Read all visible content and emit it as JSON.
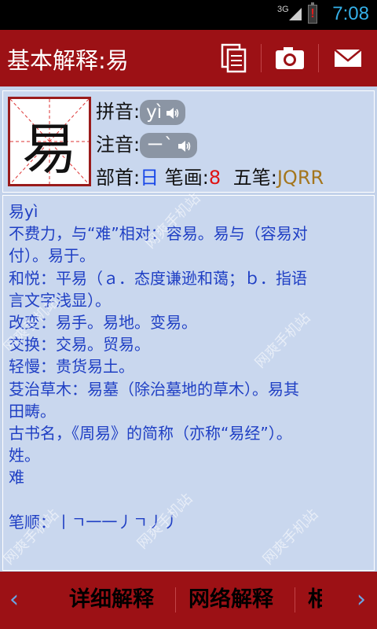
{
  "status_bar": {
    "network": "3G",
    "time": "7:08",
    "icons": [
      "signal-icon",
      "battery-alert-icon"
    ]
  },
  "header": {
    "title": "基本解释:易",
    "actions": [
      {
        "name": "copy",
        "icon": "copy-icon"
      },
      {
        "name": "camera",
        "icon": "camera-icon"
      },
      {
        "name": "mail",
        "icon": "mail-icon"
      }
    ]
  },
  "character": {
    "glyph": "易",
    "pinyin_label": "拼音:",
    "pinyin": "yì",
    "zhuyin_label": "注音:",
    "zhuyin": "ㄧˋ",
    "radical_label": "部首:",
    "radical": "日",
    "strokes_label": "笔画:",
    "strokes": "8",
    "wubi_label": "五笔:",
    "wubi": "JQRR"
  },
  "definition": {
    "lines": [
      "易yì",
      "不费力，与“难”相对：容易。易与（容易对",
      "付）。易于。",
      "和悦：平易（ａ．态度谦逊和蔼；ｂ．指语",
      "言文字浅显）。",
      "改变：易手。易地。变易。",
      "交换：交易。贸易。",
      "轻慢：贵货易土。",
      "芟治草木：易墓（除治墓地的草木）。易其",
      "田畴。",
      "古书名，《周易》的简称（亦称“易经”）。",
      "姓。",
      "难"
    ],
    "stroke_order_label": "笔顺：",
    "stroke_order": "丨ㄱ一一丿ㄱ丿丿"
  },
  "watermark": "网爽手机站",
  "bottom_tabs": {
    "prev_arrow": "‹",
    "next_arrow": "›",
    "tabs": [
      "详细解释",
      "网络解释",
      "相"
    ]
  },
  "colors": {
    "header_bg": "#9c1115",
    "panel_bg": "#c3d2ea",
    "definition_text": "#1f3fc4",
    "radical": "#1a49e8",
    "strokes": "#e01313",
    "wubi": "#a4761d",
    "clock": "#35b0e8"
  }
}
